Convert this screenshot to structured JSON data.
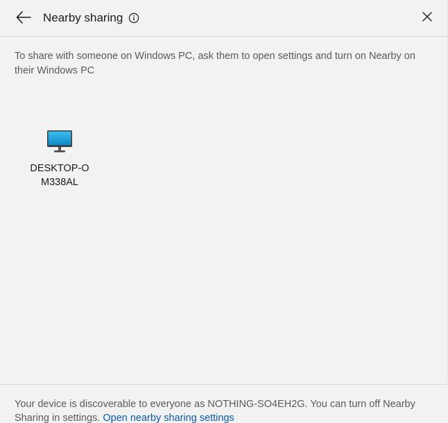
{
  "header": {
    "title": "Nearby sharing",
    "back_icon": "arrow-left-icon",
    "info_icon": "info-circle-icon",
    "close_icon": "close-icon"
  },
  "instructions": {
    "text": "To share with someone on Windows PC, ask them to open settings and turn on Nearby on their Windows PC"
  },
  "devices": [
    {
      "name": "DESKTOP-OM338AL",
      "icon": "desktop-monitor-icon"
    }
  ],
  "footer": {
    "text": "Your device is discoverable to everyone as NOTHING-SO4EH2G. You can turn off Nearby Sharing in settings.",
    "link_label": "Open nearby sharing settings"
  },
  "colors": {
    "background": "#f2f2f2",
    "text": "#1a1a1a",
    "secondary_text": "#5a5a5a",
    "link": "#0b5aa8",
    "monitor_screen": "#1ea0d8"
  }
}
